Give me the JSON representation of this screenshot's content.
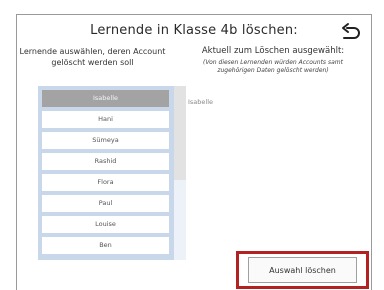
{
  "dialog": {
    "title": "Lernende in Klasse 4b löschen:",
    "back_icon": "undo-arrow-icon"
  },
  "left_panel": {
    "heading_line1": "Lernende auswählen, deren Account",
    "heading_line2": "gelöscht werden soll",
    "students": [
      "Isabelle",
      "Hani",
      "Sümeya",
      "Rashid",
      "Flora",
      "Paul",
      "Louise",
      "Ben"
    ],
    "selected_student": "Isabelle"
  },
  "right_panel": {
    "heading": "Aktuell zum Löschen ausgewählt:",
    "note_line1": "(Von diesen Lernenden würden Accounts samt",
    "note_line2": "zugehörigen Daten gelöscht werden)",
    "selected_list": [
      "Isabelle"
    ]
  },
  "actions": {
    "delete_label": "Auswahl löschen"
  },
  "colors": {
    "list_background": "#c8d8ea",
    "selected_item": "#a3a3a3",
    "highlight_frame": "#b22222"
  }
}
